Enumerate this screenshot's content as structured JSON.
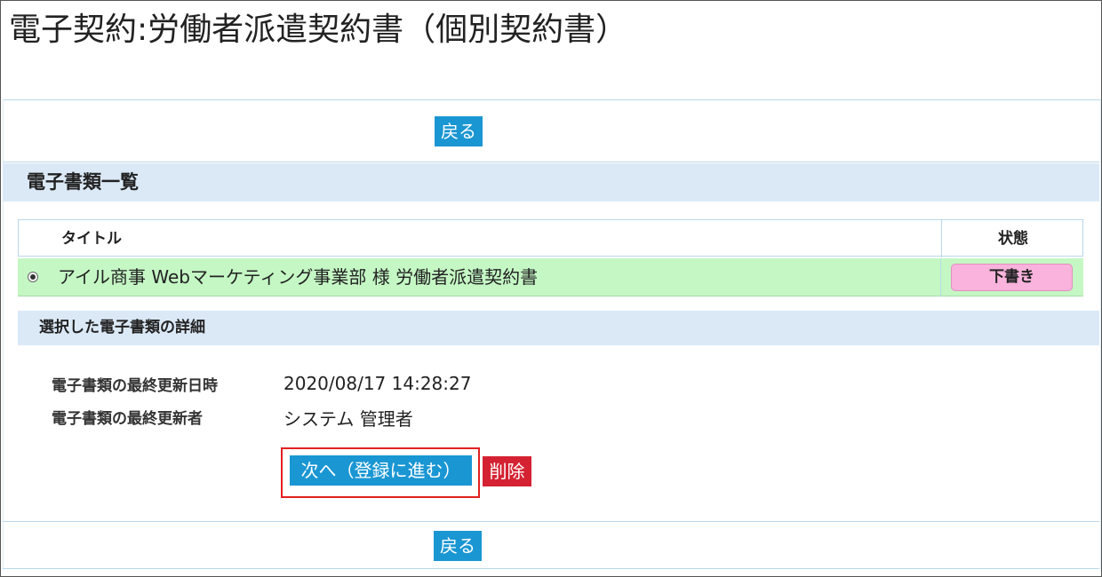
{
  "page": {
    "title": "電子契約:労働者派遣契約書（個別契約書）"
  },
  "actions": {
    "back_top_label": "戻る",
    "back_bottom_label": "戻る",
    "next_label": "次へ（登録に進む）",
    "delete_label": "削除"
  },
  "colors": {
    "primary_button": "#1a96d3",
    "delete_button": "#d42232",
    "selected_row": "#c4f7c4",
    "status_draft": "#f9b3dc",
    "section_header": "#dbe9f7",
    "highlight_border": "#e32020"
  },
  "document_list": {
    "heading": "電子書類一覧",
    "columns": {
      "title": "タイトル",
      "status": "状態"
    },
    "rows": [
      {
        "selected": true,
        "title": "アイル商事 Webマーケティング事業部 様 労働者派遣契約書",
        "status": "下書き"
      }
    ]
  },
  "details": {
    "heading": "選択した電子書類の詳細",
    "last_updated_label": "電子書類の最終更新日時",
    "last_updated_value": "2020/08/17 14:28:27",
    "last_updated_by_label": "電子書類の最終更新者",
    "last_updated_by_value": "システム 管理者"
  }
}
